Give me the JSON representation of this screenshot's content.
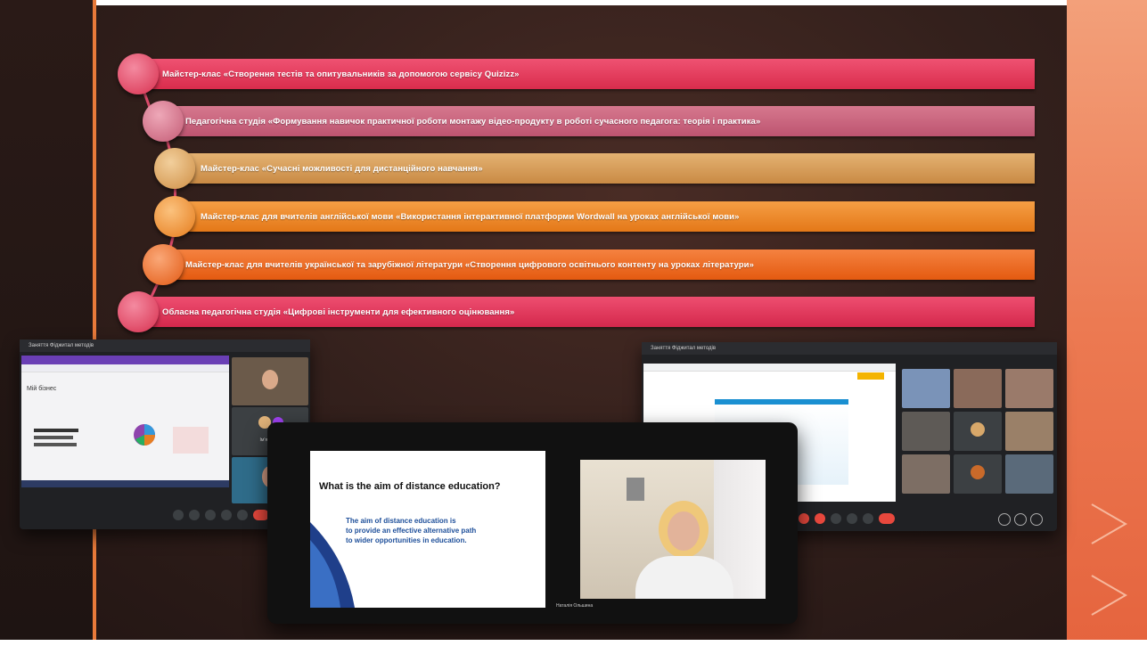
{
  "timeline": {
    "items": [
      {
        "label": "Майстер-клас «Створення тестів та опитувальників за допомогою сервісу Quizizz»",
        "color": "#e03a5a",
        "circle": "#e8506c"
      },
      {
        "label": "Педагогічна  студія «Формування навичок практичної роботи монтажу відео-продукту в роботі сучасного педагога: теорія і практика»",
        "color": "#c9607a",
        "circle": "#d97890"
      },
      {
        "label": "Майстер-клас  «Сучасні можливості для дистанційного навчання»",
        "color": "#d69a55",
        "circle": "#e2b06c"
      },
      {
        "label": "Майстер-клас для  вчителів англійської мови «Використання інтерактивної платформи Wordwall на уроках англійської мови»",
        "color": "#ee8a2a",
        "circle": "#f29a3c"
      },
      {
        "label": "Майстер-клас для  вчителів української та зарубіжної літератури «Створення цифрового освітнього контенту на уроках літератури»",
        "color": "#ee6a1e",
        "circle": "#f27a30"
      },
      {
        "label": "Обласна педагогічна студія «Цифрові інструменти для ефективного оцінювання»",
        "color": "#e0345a",
        "circle": "#e8506c"
      }
    ]
  },
  "left_window": {
    "title": "Заняття Фіджитал методів",
    "doc_title": "Мій бізнес",
    "participant": "Ім'я Уч-ця"
  },
  "right_window": {
    "title": "Заняття Фіджитал методів"
  },
  "front_window": {
    "slide_title": "What is the aim of distance education?",
    "slide_text_1": "The aim of distance education is",
    "slide_text_2": "to provide an effective alternative path",
    "slide_text_3": "to wider opportunities in education.",
    "speaker_tag": "Наталія Ольшина"
  },
  "colors": {
    "accent": "#e87a3a",
    "right_band": "#ec7a52"
  }
}
